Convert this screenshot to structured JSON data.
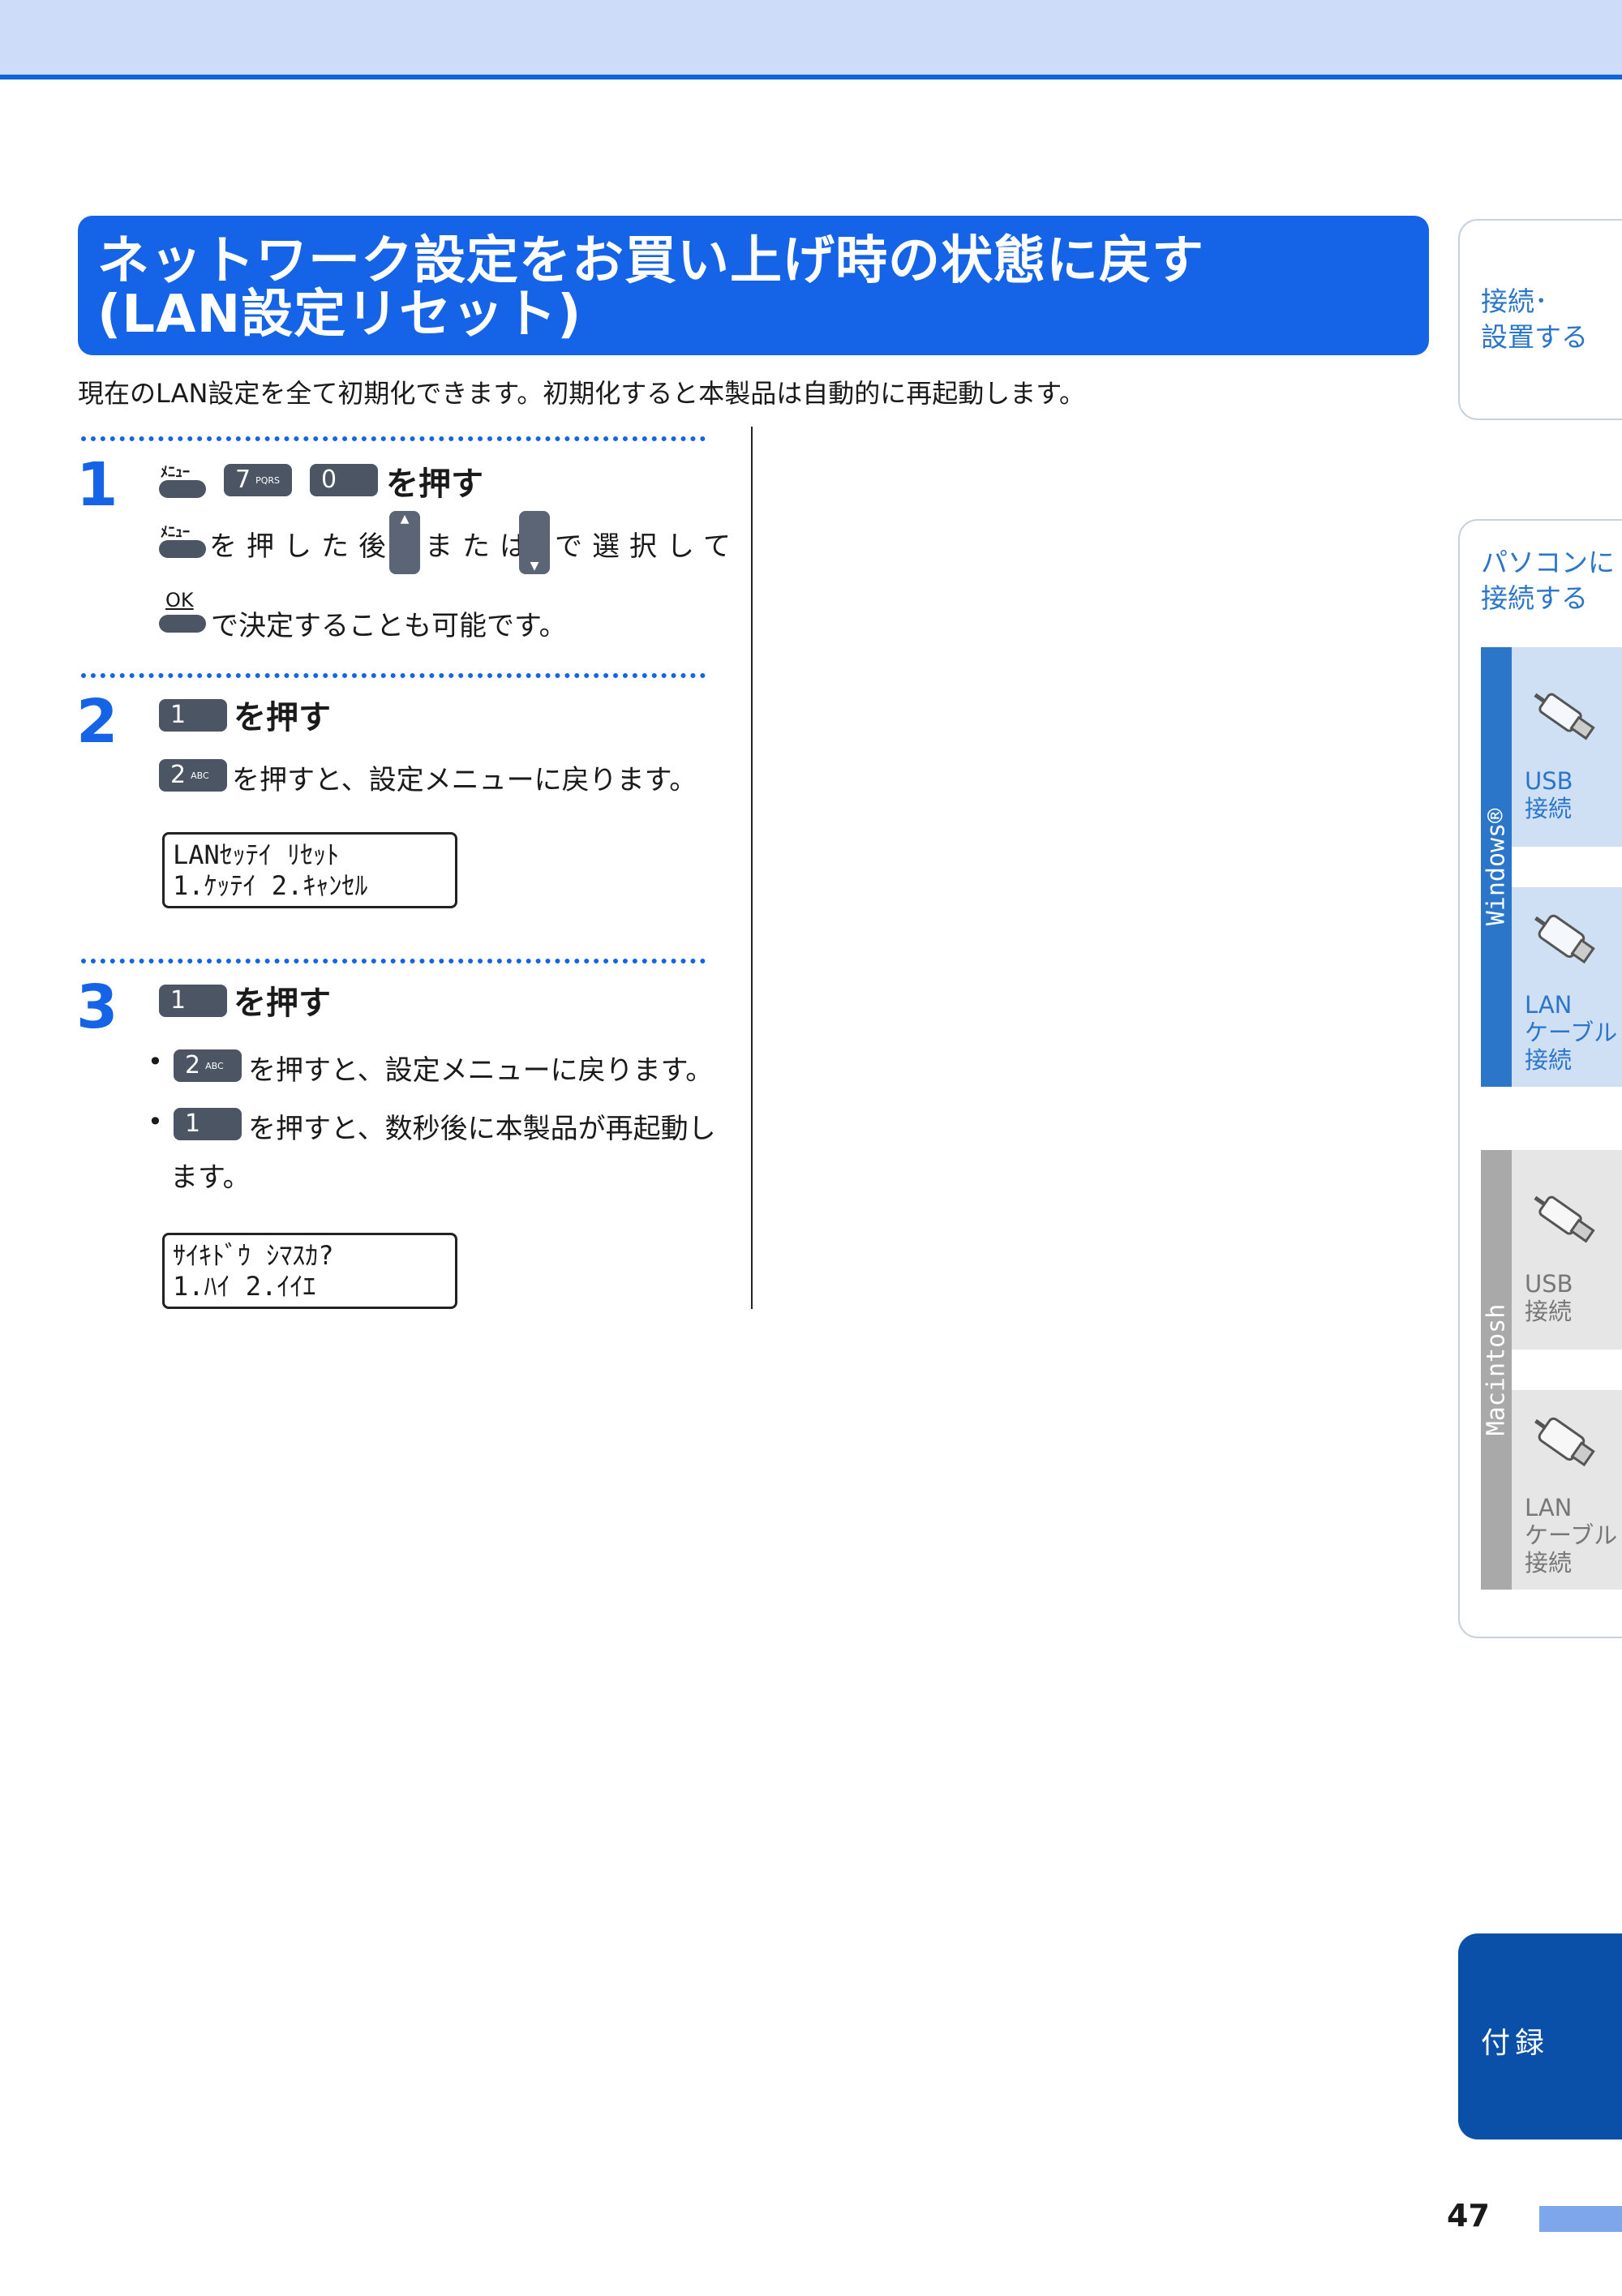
{
  "header": {
    "band_color": "#cddcf9",
    "line_color": "#1163d9"
  },
  "title": {
    "line1": "ネットワーク設定をお買い上げ時の状態に戻す",
    "line2": "(LAN設定リセット)",
    "bg_color": "#1563e6"
  },
  "intro": "現在のLAN設定を全て初期化できます。初期化すると本製品は自動的に再起動します。",
  "steps": [
    {
      "number": "1",
      "heading": "を押す",
      "keys": {
        "menu_label": "ﾒﾆｭｰ",
        "key7": "7",
        "key7_sub": "PQRS",
        "key0": "0"
      },
      "note_line1_a": "を押した後、",
      "note_line1_b": "または",
      "note_line1_c": "で選択して",
      "ok_label": "OK",
      "note_line2": "で決定することも可能です。"
    },
    {
      "number": "2",
      "key": "1",
      "heading": "を押す",
      "key2": "2",
      "key2_sub": "ABC",
      "note": "を押すと、設定メニューに戻ります。",
      "lcd": [
        "LANｾｯﾃｲ ﾘｾｯﾄ",
        "1.ｹｯﾃｲ 2.ｷｬﾝｾﾙ"
      ]
    },
    {
      "number": "3",
      "key": "1",
      "heading": "を押す",
      "bullet1_key": "2",
      "bullet1_key_sub": "ABC",
      "bullet1": "を押すと、設定メニューに戻ります。",
      "bullet2_key": "1",
      "bullet2": "を押すと、数秒後に本製品が再起動し",
      "bullet2_cont": "ます。",
      "lcd": [
        "ｻｲｷﾄﾞｳ ｼﾏｽｶ?",
        "1.ﾊｲ 2.ｲｲｴ"
      ]
    }
  ],
  "sidebar": {
    "tab1": [
      "接続･",
      "設置する"
    ],
    "tab2": [
      "パソコンに",
      "接続する"
    ],
    "windows_label": "Windows®",
    "mac_label": "Macintosh",
    "win_usb": [
      "USB",
      "接続"
    ],
    "win_lan": [
      "LAN",
      "ケーブル",
      "接続"
    ],
    "mac_usb": [
      "USB",
      "接続"
    ],
    "mac_lan": [
      "LAN",
      "ケーブル",
      "接続"
    ],
    "appendix": "付録",
    "win_color": "#2b76c9",
    "mac_color": "#a9a9a9",
    "appendix_color": "#0b50a8"
  },
  "footer": {
    "page_number": "47"
  }
}
